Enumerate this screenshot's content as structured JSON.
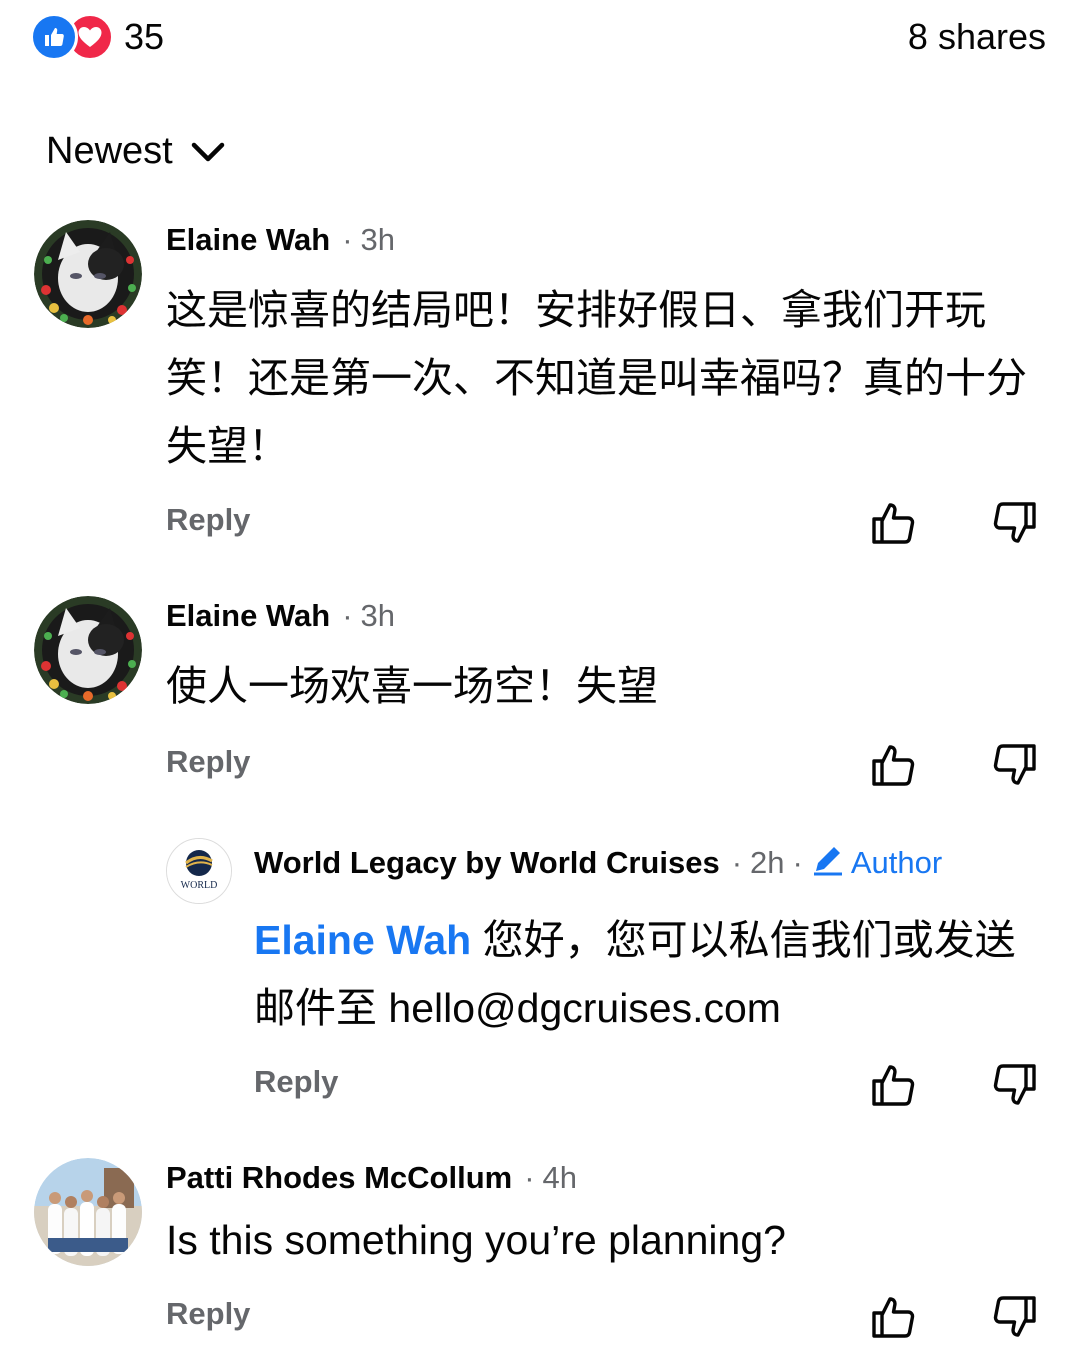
{
  "summary": {
    "reaction_count": "35",
    "shares": "8 shares",
    "reaction_icons": [
      "like-icon",
      "love-icon"
    ]
  },
  "sort": {
    "label": "Newest"
  },
  "comments": [
    {
      "author": "Elaine Wah",
      "separator": "·",
      "time": "3h",
      "text": "这是惊喜的结局吧！安排好假日、拿我们开玩笑！还是第一次、不知道是叫幸福吗？真的十分失望！",
      "reply_label": "Reply"
    },
    {
      "author": "Elaine Wah",
      "separator": "·",
      "time": "3h",
      "text": "使人一场欢喜一场空！失望",
      "reply_label": "Reply",
      "replies": [
        {
          "author": "World Legacy by World Cruises",
          "separator": "·",
          "time": "2h",
          "separator2": "·",
          "badge": "Author",
          "mention": "Elaine Wah",
          "text": " 您好，您可以私信我们或发送邮件至 hello@dgcruises.com",
          "reply_label": "Reply",
          "avatar_logo_text": "WORLD"
        }
      ]
    },
    {
      "author": "Patti Rhodes McCollum",
      "separator": "·",
      "time": "4h",
      "text": "Is this something you’re planning?",
      "reply_label": "Reply"
    }
  ],
  "colors": {
    "accent": "#1877f2",
    "love": "#f02849",
    "secondary_text": "#65676b",
    "primary_text": "#050505"
  }
}
